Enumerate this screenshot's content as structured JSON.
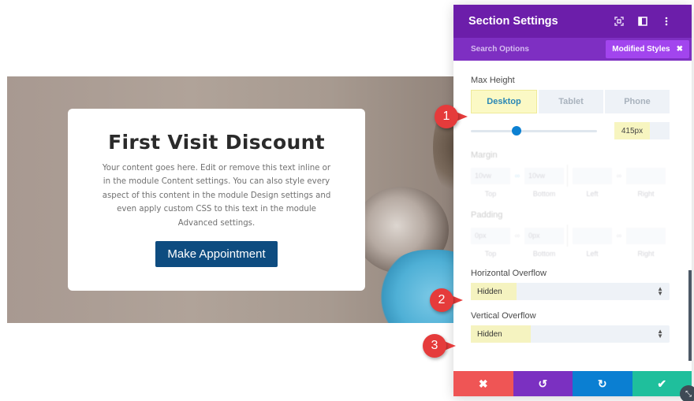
{
  "page": {
    "card": {
      "heading": "First Visit Discount",
      "body": "Your content goes here. Edit or remove this text inline or in the module Content settings. You can also style every aspect of this content in the module Design settings and even apply custom CSS to this text in the module Advanced settings.",
      "button_label": "Make Appointment"
    }
  },
  "panel": {
    "title": "Section Settings",
    "header_icons": [
      "focus-icon",
      "split-view-icon",
      "more-vertical-icon"
    ],
    "search_placeholder": "Search Options",
    "filter_badge": "Modified Styles",
    "filter_close": "✖",
    "max_height": {
      "label": "Max Height",
      "tabs": [
        "Desktop",
        "Tablet",
        "Phone"
      ],
      "active_tab": "Desktop",
      "value": "415px",
      "slider_fraction": 0.36
    },
    "margin": {
      "label": "Margin",
      "values": [
        "10vw",
        "10vw",
        "",
        ""
      ],
      "captions": [
        "Top",
        "Bottom",
        "Left",
        "Right"
      ]
    },
    "padding": {
      "label": "Padding",
      "values": [
        "0px",
        "0px",
        "",
        ""
      ],
      "captions": [
        "Top",
        "Bottom",
        "Left",
        "Right"
      ]
    },
    "horizontal_overflow": {
      "label": "Horizontal Overflow",
      "value": "Hidden"
    },
    "vertical_overflow": {
      "label": "Vertical Overflow",
      "value": "Hidden"
    },
    "footer": {
      "cancel": "✖",
      "undo": "↺",
      "redo": "↻",
      "save": "✔"
    }
  },
  "annotations": [
    "1",
    "2",
    "3"
  ],
  "colors": {
    "panel_header": "#6c1eaa",
    "panel_subheader": "#7e2fc2",
    "cta": "#0e4c80",
    "highlight": "#fbf9c5",
    "callout": "#e53b3b"
  }
}
